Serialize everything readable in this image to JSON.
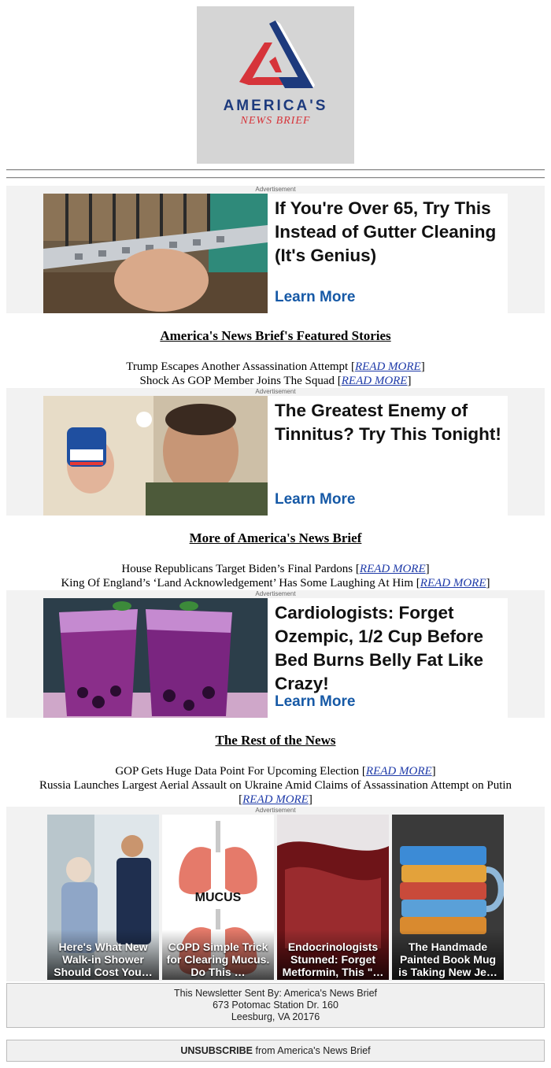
{
  "brand": {
    "name": "AMERICA'S",
    "subtitle": "NEWS BRIEF",
    "colors": {
      "navy": "#1d3a7d",
      "red": "#d6343a",
      "ad_link": "#1659a6",
      "story_link": "#1e3aa8"
    }
  },
  "ads": [
    {
      "label": "Advertisement",
      "headline": "If You're Over 65, Try This Instead of Gutter Cleaning (It's Genius)",
      "cta": "Learn More",
      "image": "gutter-guard-photo"
    },
    {
      "label": "Advertisement",
      "headline": "The Greatest Enemy of Tinnitus? Try This Tonight!",
      "cta": "Learn More",
      "image": "man-ear-vapor-rub-photo"
    },
    {
      "label": "Advertisement",
      "headline": "Cardiologists: Forget Ozempic, 1/2 Cup Before Bed Burns Belly Fat Like Crazy!",
      "cta": "Learn More",
      "image": "purple-drink-photo"
    }
  ],
  "sections": [
    {
      "title": "America's News Brief's Featured Stories",
      "stories": [
        {
          "text": "Trump Escapes Another Assassination Attempt",
          "link": "READ MORE"
        },
        {
          "text": "Shock As GOP Member Joins The Squad",
          "link": "READ MORE"
        }
      ]
    },
    {
      "title": "More of America's News Brief",
      "stories": [
        {
          "text": "House Republicans Target Biden’s Final Pardons",
          "link": "READ MORE"
        },
        {
          "text": "King Of England’s ‘Land Acknowledgement’ Has Some Laughing At Him",
          "link": "READ MORE"
        }
      ]
    },
    {
      "title": "The Rest of the News",
      "stories": [
        {
          "text": "GOP Gets Huge Data Point For Upcoming Election",
          "link": "READ MORE"
        },
        {
          "text": "Russia Launches Largest Aerial Assault on Ukraine Amid Claims of Assassination Attempt on Putin",
          "link": "READ MORE"
        }
      ]
    }
  ],
  "bottom_ad": {
    "label": "Advertisement",
    "cards": [
      {
        "caption": "Here's What New Walk-in Shower Should Cost You…",
        "image": "walk-in-shower-photo"
      },
      {
        "caption": "COPD Simple Trick for Clearing Mucus. Do This …",
        "image": "lungs-mucus-illustration",
        "image_text": "MUCUS"
      },
      {
        "caption": "Endocrinologists Stunned: Forget Metformin, This \"…",
        "image": "red-gel-photo"
      },
      {
        "caption": "The Handmade Painted Book Mug is Taking New Je…",
        "image": "book-mug-photo"
      }
    ]
  },
  "footer": {
    "line1": "This Newsletter Sent By: America's News Brief",
    "line2": "673 Potomac Station Dr. 160",
    "line3": "Leesburg, VA 20176"
  },
  "unsubscribe": {
    "link": "UNSUBSCRIBE",
    "text": " from America's News Brief"
  }
}
